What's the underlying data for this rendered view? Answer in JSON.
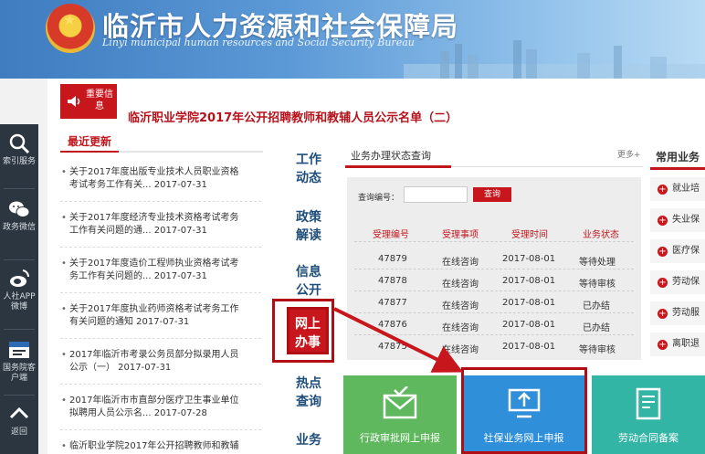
{
  "header": {
    "title": "临沂市人力资源和社会保障局",
    "subtitle": "Linyi municipal human resources and Social Security Bureau"
  },
  "left_sidebar": {
    "items": [
      {
        "label": "索引服务",
        "icon": "search-icon"
      },
      {
        "label": "政务微信",
        "icon": "wechat-icon"
      },
      {
        "label": "人社APP微博",
        "icon": "weibo-icon"
      },
      {
        "label": "国务院客户端",
        "icon": "state-council-icon"
      },
      {
        "label": "返回",
        "icon": "chevron-up-icon"
      }
    ]
  },
  "notice": {
    "badge_label": "重要信息",
    "title": "临沂职业学院2017年公开招聘教师和教辅人员公示名单（二）"
  },
  "recent": {
    "heading": "最近更新",
    "items": [
      {
        "line1": "关于2017年度出版专业技术人员职业资格",
        "line2": "考试考务工作有关... 2017-07-31"
      },
      {
        "line1": "关于2017年度经济专业技术资格考试考务",
        "line2": "工作有关问题的通... 2017-07-31"
      },
      {
        "line1": "关于2017年度造价工程师执业资格考试考",
        "line2": "务工作有关问题的... 2017-07-31"
      },
      {
        "line1": "关于2017年度执业药师资格考试考务工作",
        "line2": "有关问题的通知 2017-07-31"
      },
      {
        "line1": "2017年临沂市考录公务员部分拟录用人员",
        "line2": "公示（一） 2017-07-31"
      },
      {
        "line1": "2017年临沂市市直部分医疗卫生事业单位",
        "line2": "拟聘用人员公示名... 2017-07-28"
      },
      {
        "line1": "临沂职业学院2017年公开招聘教师和教辅",
        "line2": ""
      }
    ]
  },
  "categories": [
    "工作动态",
    "政策解读",
    "信息公开",
    "网上办事",
    "热点查询",
    "业务"
  ],
  "query": {
    "tab_label": "业务办理状态查询",
    "more_label": "更多+",
    "field_label": "查询编号：",
    "button_label": "查询",
    "columns": [
      "受理编号",
      "受理事项",
      "受理时间",
      "业务状态"
    ],
    "rows": [
      [
        "47879",
        "在线咨询",
        "2017-08-01",
        "等待处理"
      ],
      [
        "47878",
        "在线咨询",
        "2017-08-01",
        "等待审核"
      ],
      [
        "47877",
        "在线咨询",
        "2017-08-01",
        "已办结"
      ],
      [
        "47876",
        "在线咨询",
        "2017-08-01",
        "已办结"
      ],
      [
        "47875",
        "在线咨询",
        "2017-08-01",
        "等待审核"
      ]
    ]
  },
  "services": {
    "heading": "常用业务",
    "items": [
      "就业培",
      "失业保",
      "医疗保",
      "劳动保",
      "劳动服",
      "离职退"
    ]
  },
  "tiles": [
    {
      "label": "行政审批网上申报",
      "icon": "envelope-check-icon",
      "color": "#5fb85e"
    },
    {
      "label": "社保业务网上申报",
      "icon": "monitor-upload-icon",
      "color": "#2f8fd8"
    },
    {
      "label": "劳动合同备案",
      "icon": "contract-edit-icon",
      "color": "#33b5a5"
    }
  ]
}
